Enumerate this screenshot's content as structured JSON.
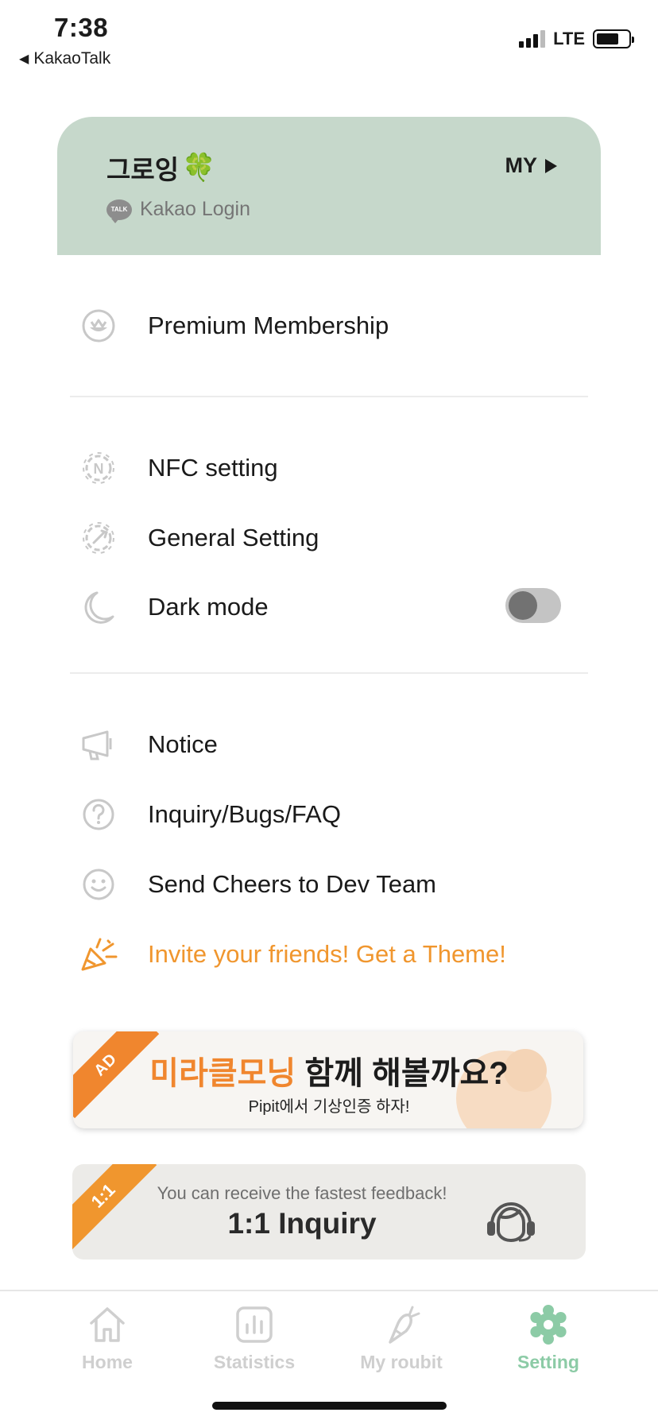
{
  "status_bar": {
    "time": "7:38",
    "back_app": "KakaoTalk",
    "network": "LTE"
  },
  "profile": {
    "name": "그로잉",
    "emoji": "🍀",
    "my_link": "MY",
    "login_badge": "TALK",
    "login_method": "Kakao Login"
  },
  "menu": {
    "premium": "Premium Membership",
    "nfc": "NFC setting",
    "general": "General Setting",
    "dark_mode": "Dark mode",
    "dark_mode_on": false,
    "notice": "Notice",
    "inquiry": "Inquiry/Bugs/FAQ",
    "cheers": "Send Cheers to Dev Team",
    "invite": "Invite your friends! Get a Theme!"
  },
  "ad_banner": {
    "ribbon": "AD",
    "title_highlight": "미라클모닝",
    "title_rest": " 함께 해볼까요?",
    "subtitle": "Pipit에서 기상인증 하자!"
  },
  "inquiry_banner": {
    "ribbon": "1:1",
    "subtitle": "You can receive the fastest feedback!",
    "title": "1:1 Inquiry"
  },
  "tabs": [
    {
      "label": "Home",
      "icon": "home-icon",
      "active": false
    },
    {
      "label": "Statistics",
      "icon": "statistics-icon",
      "active": false
    },
    {
      "label": "My roubit",
      "icon": "carrot-icon",
      "active": false
    },
    {
      "label": "Setting",
      "icon": "gear-icon",
      "active": true
    }
  ],
  "colors": {
    "profile_card": "#c6d8cb",
    "accent_orange": "#f0962e",
    "tab_active": "#8ccba6",
    "tab_inactive": "#cfcfcf"
  }
}
